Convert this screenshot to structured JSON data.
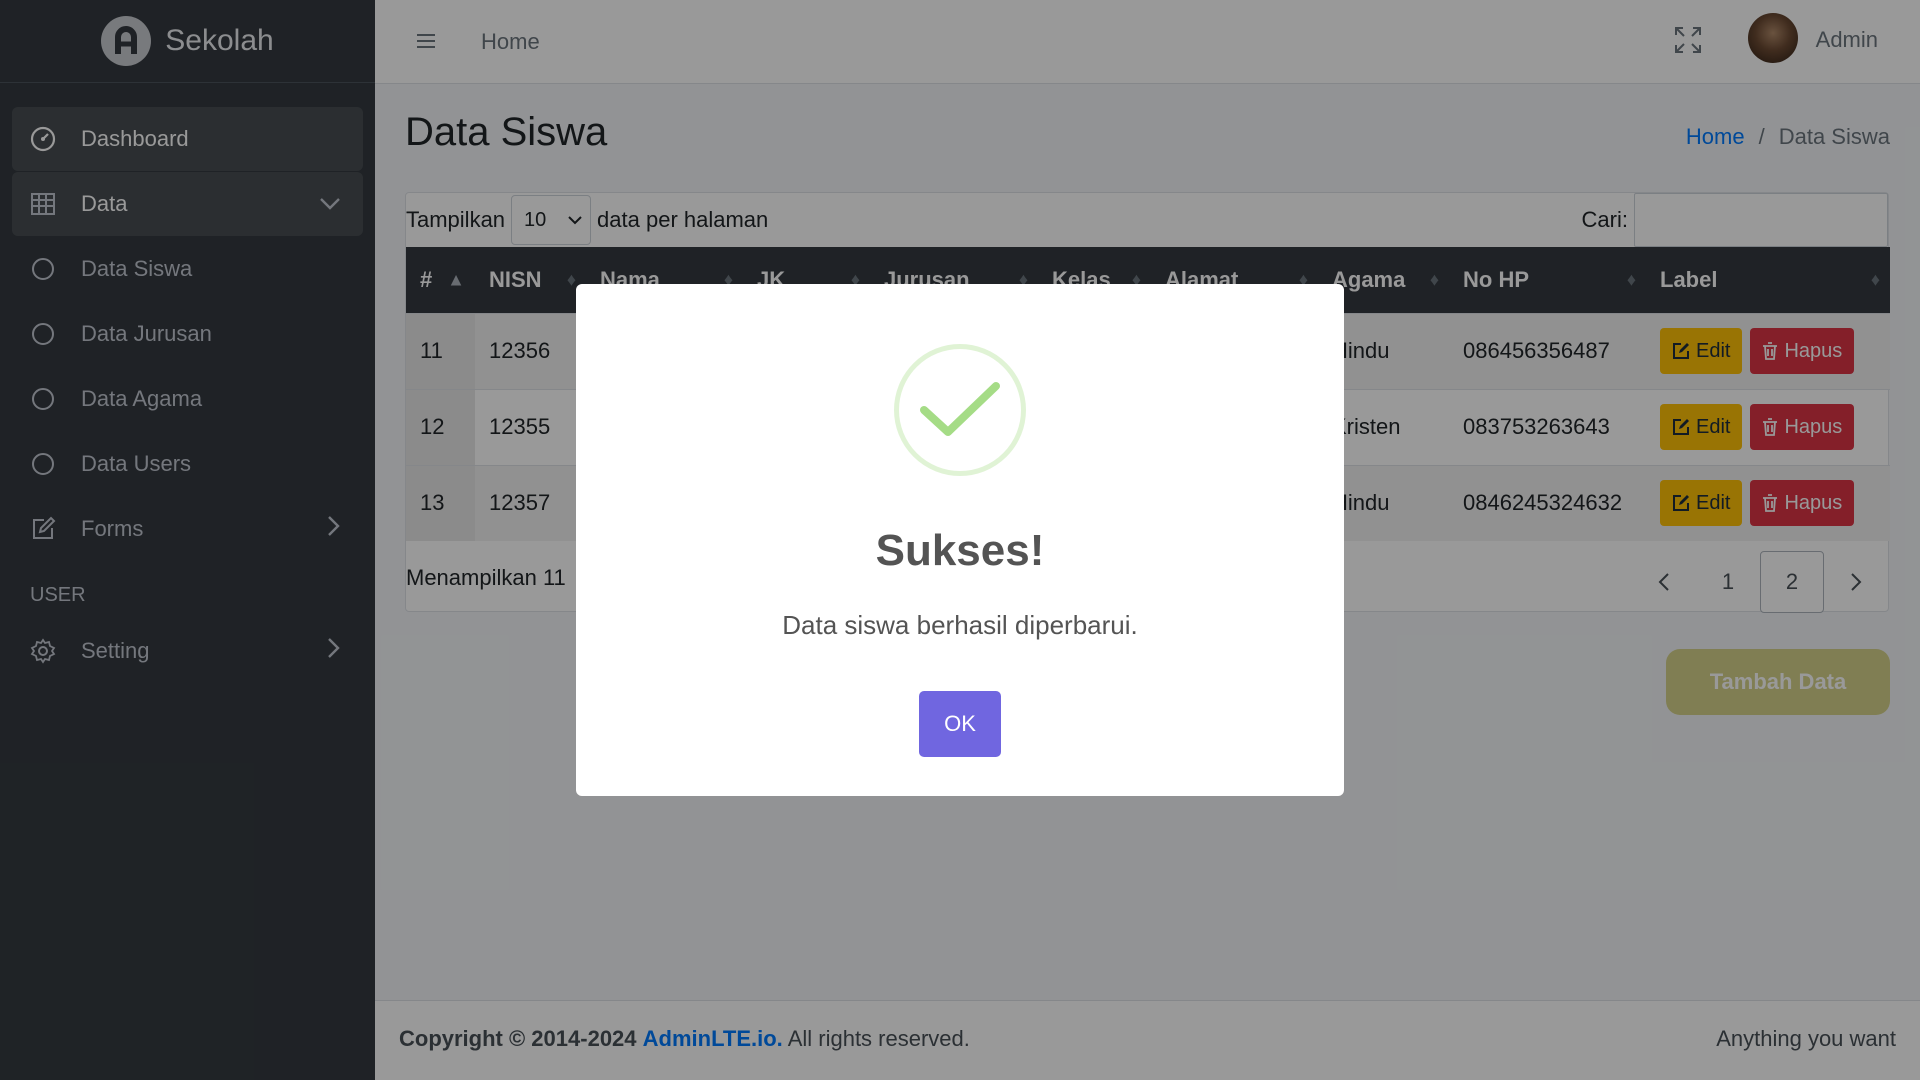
{
  "brand": {
    "name": "Sekolah"
  },
  "sidebar": {
    "items": [
      {
        "label": "Dashboard",
        "icon": "dashboard-icon"
      },
      {
        "label": "Data",
        "icon": "table-icon"
      },
      {
        "label": "Data Siswa",
        "icon": "circle-icon"
      },
      {
        "label": "Data Jurusan",
        "icon": "circle-icon"
      },
      {
        "label": "Data Agama",
        "icon": "circle-icon"
      },
      {
        "label": "Data Users",
        "icon": "circle-icon"
      },
      {
        "label": "Forms",
        "icon": "edit-icon"
      }
    ],
    "header": "USER",
    "setting": {
      "label": "Setting",
      "icon": "gear-icon"
    }
  },
  "topbar": {
    "home": "Home",
    "user": "Admin"
  },
  "page": {
    "title": "Data Siswa",
    "breadcrumb": [
      "Home",
      "/",
      "Data Siswa"
    ]
  },
  "table": {
    "show_label": "Tampilkan",
    "page_size": "10",
    "per_page_label": "data per halaman",
    "search_label": "Cari:",
    "columns": [
      "#",
      "NISN",
      "Nama",
      "JK",
      "Jurusan",
      "Kelas",
      "Alamat",
      "Agama",
      "No HP",
      "Label"
    ],
    "rows": [
      {
        "no": "11",
        "nisn": "12356",
        "agama": "Hindu",
        "hp": "086456356487"
      },
      {
        "no": "12",
        "nisn": "12355",
        "agama": "Kristen",
        "hp": "083753263643"
      },
      {
        "no": "13",
        "nisn": "12357",
        "agama": "Hindu",
        "hp": "0846245324632"
      }
    ],
    "edit_label": "Edit",
    "delete_label": "Hapus",
    "info": "Menampilkan 11",
    "pages": [
      "1",
      "2"
    ],
    "current_page": "2"
  },
  "add_button": "Tambah Data",
  "footer": {
    "copyright": "Copyright © 2014-2024",
    "link": "AdminLTE.io.",
    "rights": "All rights reserved.",
    "right_text": "Anything you want"
  },
  "modal": {
    "title": "Sukses!",
    "text": "Data siswa berhasil diperbarui.",
    "ok": "OK",
    "success_color": "#a5dc86",
    "button_color": "#7066e0"
  }
}
